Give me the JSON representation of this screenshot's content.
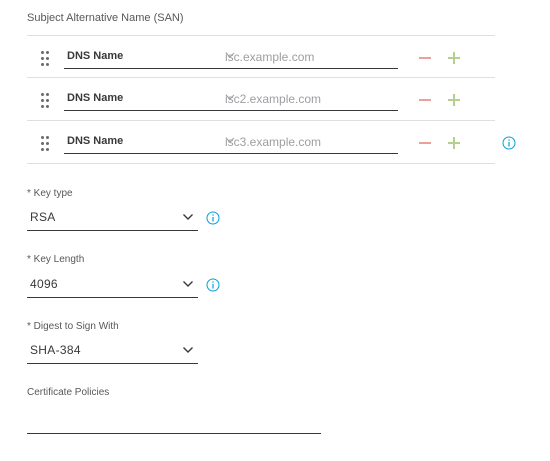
{
  "san": {
    "title": "Subject Alternative Name (SAN)",
    "rows": [
      {
        "type": "DNS Name",
        "value": "isc.example.com"
      },
      {
        "type": "DNS Name",
        "value": "isc2.example.com"
      },
      {
        "type": "DNS Name",
        "value": "isc3.example.com"
      }
    ]
  },
  "key_type": {
    "label": "* Key type",
    "value": "RSA"
  },
  "key_length": {
    "label": "* Key Length",
    "value": "4096"
  },
  "digest": {
    "label": "* Digest to Sign With",
    "value": "SHA-384"
  },
  "cert_policies": {
    "label": "Certificate Policies",
    "value": ""
  },
  "colors": {
    "text": "#39393b",
    "label": "#58585b",
    "placeholder": "#9e9ea2",
    "minus": "#e8a19b",
    "plus": "#b5cf8f",
    "info": "#049fd9",
    "divider": "#dfdfdf"
  },
  "icons": {
    "drag": "drag-handle-icon",
    "chevron": "chevron-down-icon",
    "minus": "minus-icon",
    "plus": "plus-icon",
    "info": "info-icon"
  }
}
